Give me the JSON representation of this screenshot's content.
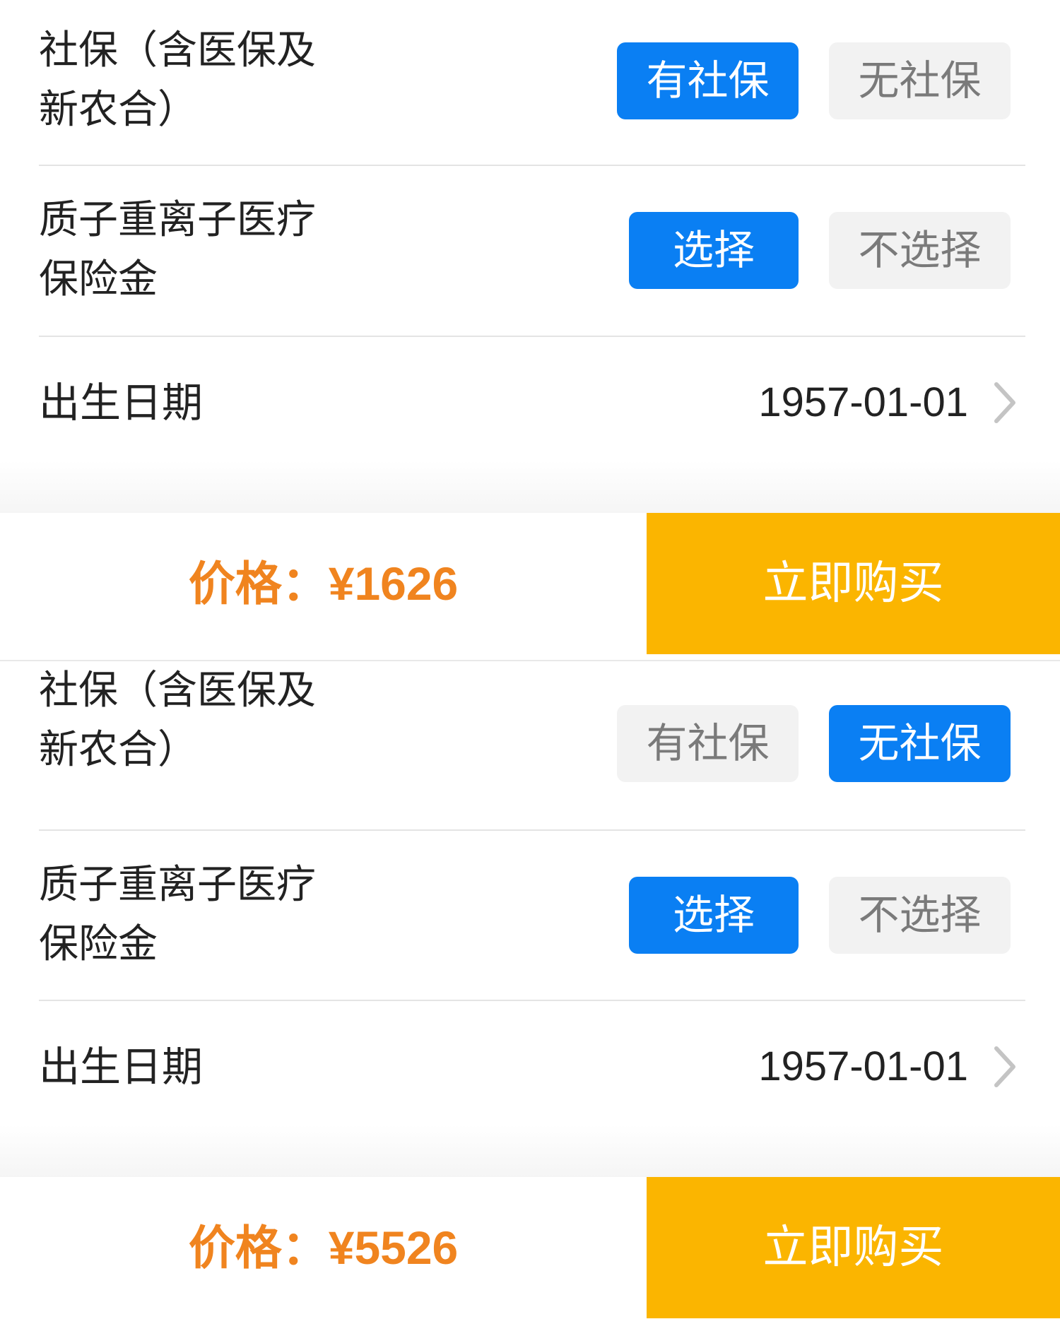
{
  "sections": [
    {
      "social_label": "社保（含医保及\n新农合）",
      "social_options": [
        "有社保",
        "无社保"
      ],
      "social_selected": 0,
      "heavy_label": "质子重离子医疗\n保险金",
      "heavy_options": [
        "选择",
        "不选择"
      ],
      "heavy_selected": 0,
      "dob_label": "出生日期",
      "dob_value": "1957-01-01",
      "price_prefix": "价格：",
      "price_value": "¥1626",
      "buy_label": "立即购买"
    },
    {
      "social_label": "社保（含医保及\n新农合）",
      "social_options": [
        "有社保",
        "无社保"
      ],
      "social_selected": 1,
      "heavy_label": "质子重离子医疗\n保险金",
      "heavy_options": [
        "选择",
        "不选择"
      ],
      "heavy_selected": 0,
      "dob_label": "出生日期",
      "dob_value": "1957-01-01",
      "price_prefix": "价格：",
      "price_value": "¥5526",
      "buy_label": "立即购买"
    }
  ],
  "colors": {
    "active_blue": "#0a7ff3",
    "inactive_gray": "#f2f2f2",
    "price_orange": "#f0841f",
    "buy_yellow": "#fbb500"
  }
}
